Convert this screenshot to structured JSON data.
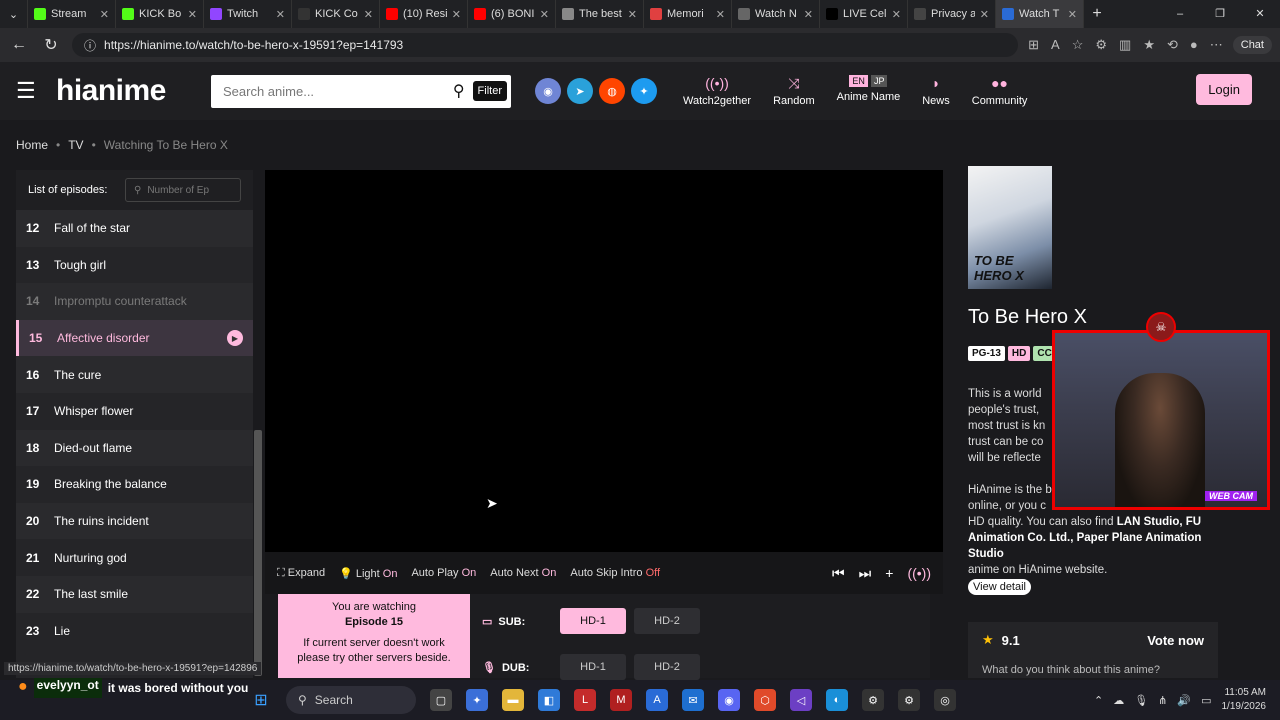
{
  "browser": {
    "tabs": [
      {
        "title": "Stream",
        "color": "#53fc18"
      },
      {
        "title": "KICK Bo",
        "color": "#53fc18"
      },
      {
        "title": "Twitch",
        "color": "#9146ff"
      },
      {
        "title": "KICK Co",
        "color": "#333333"
      },
      {
        "title": "(10) Resi",
        "color": "#ff0000"
      },
      {
        "title": "(6) BONI",
        "color": "#ff0000"
      },
      {
        "title": "The best",
        "color": "#888888"
      },
      {
        "title": "Memori",
        "color": "#e04040"
      },
      {
        "title": "Watch N",
        "color": "#666666"
      },
      {
        "title": "LIVE Cel",
        "color": "#000000"
      },
      {
        "title": "Privacy a",
        "color": "#444444"
      },
      {
        "title": "Watch T",
        "color": "#2a6bd6"
      }
    ],
    "url": "https://hianime.to/watch/to-be-hero-x-19591?ep=141793",
    "chat_label": "Chat"
  },
  "site": {
    "logo": "hianime",
    "search_placeholder": "Search anime...",
    "filter_label": "Filter",
    "nav": [
      {
        "icon": "broadcast-icon",
        "label": "Watch2gether"
      },
      {
        "icon": "shuffle-icon",
        "label": "Random"
      },
      {
        "icon": "lang-toggle",
        "label": "Anime Name",
        "lang": [
          "EN",
          "JP"
        ]
      },
      {
        "icon": "rss-icon",
        "label": "News"
      },
      {
        "icon": "chat-icon",
        "label": "Community"
      }
    ],
    "login_label": "Login"
  },
  "breadcrumb": [
    "Home",
    "TV",
    "Watching To Be Hero X"
  ],
  "episodes": {
    "header_label": "List of episodes:",
    "search_placeholder": "Number of Ep",
    "items": [
      {
        "num": "12",
        "title": "Fall of the star",
        "state": "normal"
      },
      {
        "num": "13",
        "title": "Tough girl",
        "state": "normal"
      },
      {
        "num": "14",
        "title": "Impromptu counterattack",
        "state": "watched"
      },
      {
        "num": "15",
        "title": "Affective disorder",
        "state": "active"
      },
      {
        "num": "16",
        "title": "The cure",
        "state": "normal"
      },
      {
        "num": "17",
        "title": "Whisper flower",
        "state": "normal"
      },
      {
        "num": "18",
        "title": "Died-out flame",
        "state": "normal"
      },
      {
        "num": "19",
        "title": "Breaking the balance",
        "state": "normal"
      },
      {
        "num": "20",
        "title": "The ruins incident",
        "state": "normal"
      },
      {
        "num": "21",
        "title": "Nurturing god",
        "state": "normal"
      },
      {
        "num": "22",
        "title": "The last smile",
        "state": "normal"
      },
      {
        "num": "23",
        "title": "Lie",
        "state": "normal"
      }
    ]
  },
  "player": {
    "expand_label": "Expand",
    "light_label": "Light",
    "light_state": "On",
    "autoplay_label": "Auto Play",
    "autoplay_state": "On",
    "autonext_label": "Auto Next",
    "autonext_state": "On",
    "autoskip_label": "Auto Skip Intro",
    "autoskip_state": "Off"
  },
  "servers": {
    "watching_line1": "You are watching",
    "watching_episode": "Episode 15",
    "watching_line3": "If current server doesn't work please try other servers beside.",
    "sub_label": "SUB:",
    "dub_label": "DUB:",
    "sub": [
      "HD-1",
      "HD-2"
    ],
    "dub": [
      "HD-1",
      "HD-2"
    ]
  },
  "anime": {
    "title": "To Be Hero X",
    "poster_text": "TO BE HERO X",
    "badges": [
      "PG-13",
      "HD",
      "CC"
    ],
    "desc_lines": [
      "This is a world",
      "people's trust,",
      "most trust is kn",
      "trust can be co",
      "will be reflecte"
    ],
    "desc2_lines": [
      "HiAnime is the b",
      "online, or you c"
    ],
    "desc2_tail": "HD quality. You can also find",
    "desc2_studio_partial": "LAN Studio, FU",
    "desc2_studios": "Animation Co. Ltd., Paper Plane Animation Studio",
    "desc2_end": "anime on HiAnime website.",
    "view_detail_label": "View detail",
    "rating": "9.1",
    "vote_label": "Vote now",
    "vote_question": "What do you think about this anime?"
  },
  "webcam": {
    "label": "WEB CAM"
  },
  "status_url": "https://hianime.to/watch/to-be-hero-x-19591?ep=142896",
  "chat_overlay": {
    "user": "evelyyn_ot",
    "message": "it was bored without you"
  },
  "taskbar": {
    "search_label": "Search",
    "time": "11:05 AM",
    "date": "1/19/2026"
  }
}
